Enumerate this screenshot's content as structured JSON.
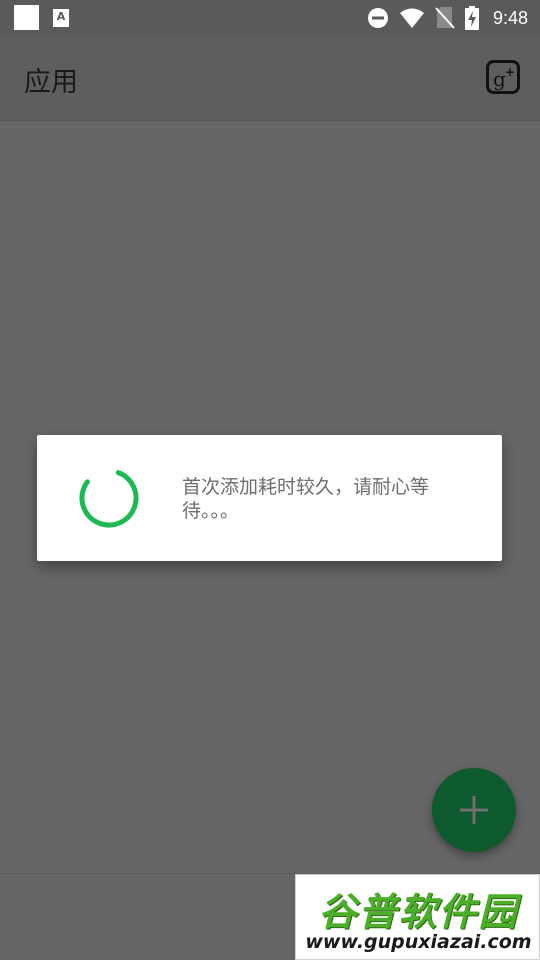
{
  "status_bar": {
    "time": "9:48",
    "left_icons": [
      "square-notification-icon",
      "font-a-notification-icon"
    ],
    "font_icon_glyph": "A",
    "right_icons": [
      "do-not-disturb-icon",
      "wifi-icon",
      "no-sim-icon",
      "battery-charging-icon"
    ]
  },
  "app_bar": {
    "title": "应用",
    "action_icon": "google-plus-icon"
  },
  "dialog": {
    "message": "首次添加耗时较久，请耐心等待。。。",
    "spinner_color": "#1db954"
  },
  "fab": {
    "icon": "plus-icon",
    "color": "#0d5a2e"
  },
  "watermark": {
    "title": "谷普软件园",
    "url": "www.gupuxiazai.com"
  },
  "colors": {
    "scrim": "#666666",
    "dialog_bg": "#ffffff",
    "accent": "#1db954"
  }
}
